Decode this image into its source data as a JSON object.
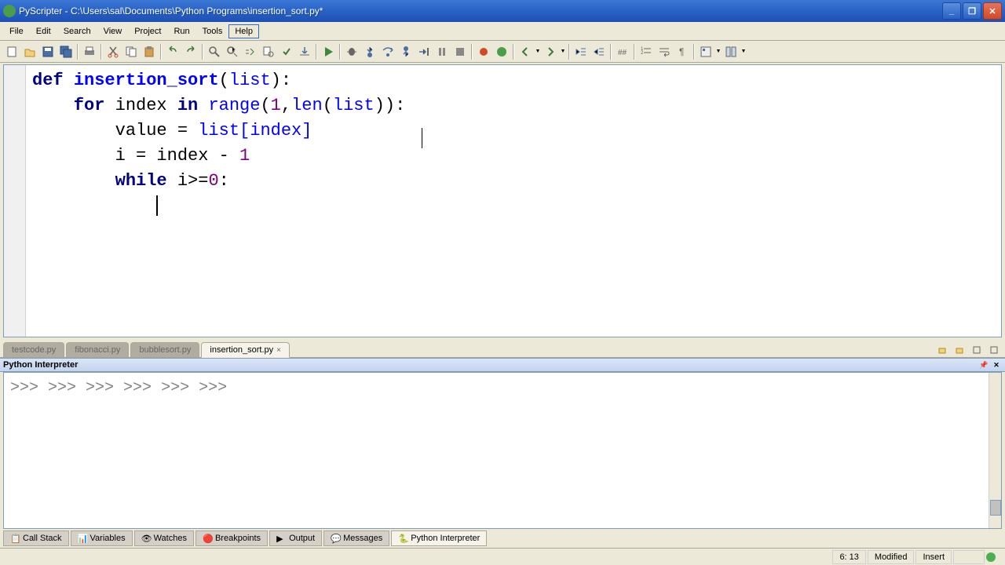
{
  "window": {
    "title": "PyScripter - C:\\Users\\sal\\Documents\\Python Programs\\insertion_sort.py*"
  },
  "menubar": {
    "file": "File",
    "edit": "Edit",
    "search": "Search",
    "view": "View",
    "project": "Project",
    "run": "Run",
    "tools": "Tools",
    "help": "Help"
  },
  "code": {
    "l1a": "def ",
    "l1b": "insertion_sort",
    "l1c": "(",
    "l1d": "list",
    "l1e": "):",
    "l2a": "    for ",
    "l2b": "index ",
    "l2c": "in ",
    "l2d": "range",
    "l2e": "(",
    "l2f": "1",
    "l2g": ",",
    "l2h": "len",
    "l2i": "(",
    "l2j": "list",
    "l2k": ")):",
    "l3a": "        value = ",
    "l3b": "list[index]",
    "l4a": "        i = index - ",
    "l4b": "1",
    "l5a": "        while ",
    "l5b": "i>=",
    "l5c": "0",
    "l5d": ":",
    "l6a": "            "
  },
  "tabs": {
    "t1": "testcode.py",
    "t2": "fibonacci.py",
    "t3": "bubblesort.py",
    "t4": "insertion_sort.py"
  },
  "interpreter": {
    "title": "Python Interpreter",
    "prompt": ">>> "
  },
  "bottom_tabs": {
    "call_stack": "Call Stack",
    "variables": "Variables",
    "watches": "Watches",
    "breakpoints": "Breakpoints",
    "output": "Output",
    "messages": "Messages",
    "python_interpreter": "Python Interpreter"
  },
  "status": {
    "position": "6: 13",
    "modified": "Modified",
    "mode": "Insert"
  }
}
